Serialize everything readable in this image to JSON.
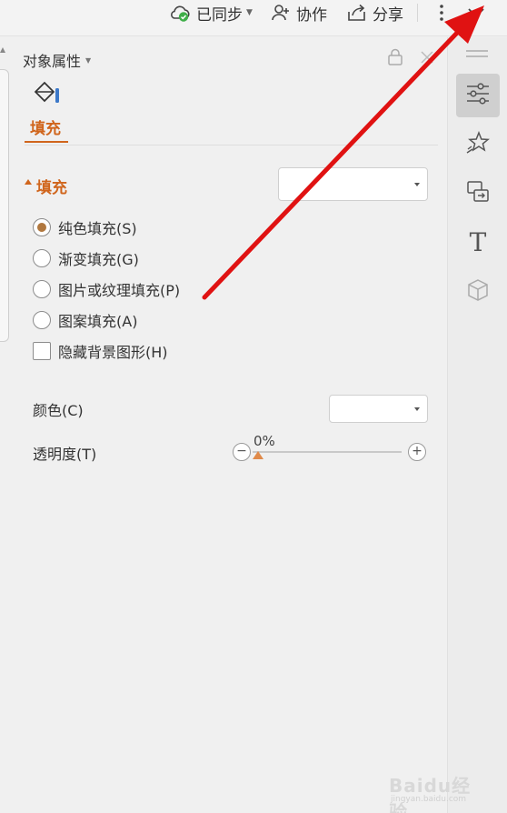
{
  "topbar": {
    "sync_label": "已同步",
    "collab_label": "协作",
    "share_label": "分享"
  },
  "panel": {
    "title": "对象属性",
    "tab_fill": "填充",
    "section_title": "填充",
    "fill_dropdown_value": "",
    "options": [
      {
        "label": "纯色填充(S)",
        "type": "radio",
        "checked": true
      },
      {
        "label": "渐变填充(G)",
        "type": "radio",
        "checked": false
      },
      {
        "label": "图片或纹理填充(P)",
        "type": "radio",
        "checked": false
      },
      {
        "label": "图案填充(A)",
        "type": "radio",
        "checked": false
      },
      {
        "label": "隐藏背景图形(H)",
        "type": "checkbox",
        "checked": false
      }
    ],
    "color_label": "颜色(C)",
    "color_value": "",
    "transparency_label": "透明度(T)",
    "transparency_value": "0%",
    "transparency_fraction": 0
  },
  "sidebar": {
    "items": [
      "properties-icon",
      "animation-icon",
      "transition-icon",
      "text-icon",
      "3d-icon"
    ]
  },
  "watermark": {
    "text": "Baidu经验",
    "url": "jingyan.baidu.com"
  },
  "colors": {
    "accent": "#d0651c",
    "radio_dot": "#b1783f",
    "arrow": "#e01212",
    "slider_thumb": "#e08a4a"
  }
}
